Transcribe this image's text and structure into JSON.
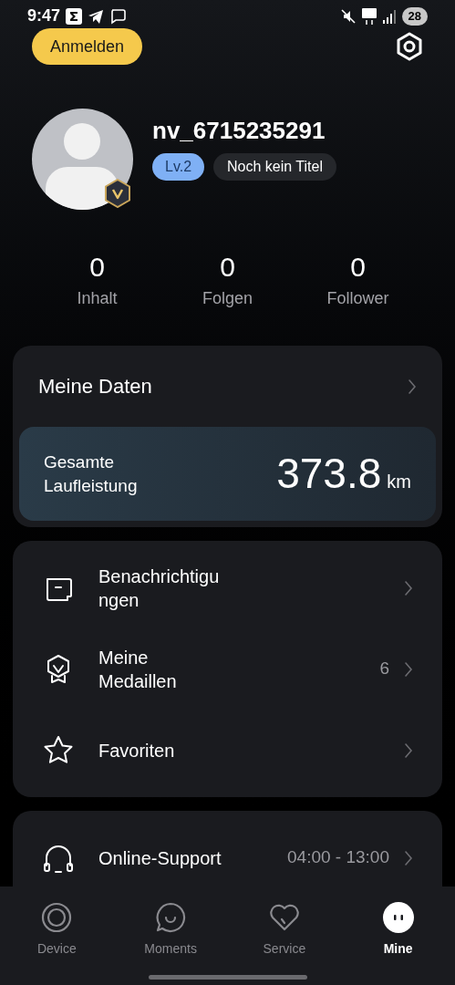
{
  "status_bar": {
    "time": "9:47",
    "battery": "28"
  },
  "header": {
    "login_button": "Anmelden"
  },
  "profile": {
    "username": "nv_6715235291",
    "level_badge": "Lv.2",
    "title_badge": "Noch kein Titel"
  },
  "stats": [
    {
      "value": "0",
      "label": "Inhalt"
    },
    {
      "value": "0",
      "label": "Folgen"
    },
    {
      "value": "0",
      "label": "Follower"
    }
  ],
  "my_data": {
    "title": "Meine Daten",
    "total_label_lines": [
      "Gesamte",
      "Laufleistung"
    ],
    "total_value": "373.8",
    "total_unit": "km"
  },
  "menu": [
    {
      "kind": "message",
      "label_lines": [
        "Benachrichtigu",
        "ngen"
      ]
    },
    {
      "kind": "medal",
      "label_lines": [
        "Meine",
        "Medaillen"
      ],
      "value": "6"
    },
    {
      "kind": "star",
      "label_lines": [
        "Favoriten"
      ]
    }
  ],
  "support": {
    "kind": "headset",
    "label_lines": [
      "Online-Support"
    ],
    "value": "04:00 - 13:00"
  },
  "bottom_nav": [
    {
      "kind": "device",
      "label": "Device",
      "selected": false
    },
    {
      "kind": "moments",
      "label": "Moments",
      "selected": false
    },
    {
      "kind": "service",
      "label": "Service",
      "selected": false
    },
    {
      "kind": "mine",
      "label": "Mine",
      "selected": true
    }
  ]
}
